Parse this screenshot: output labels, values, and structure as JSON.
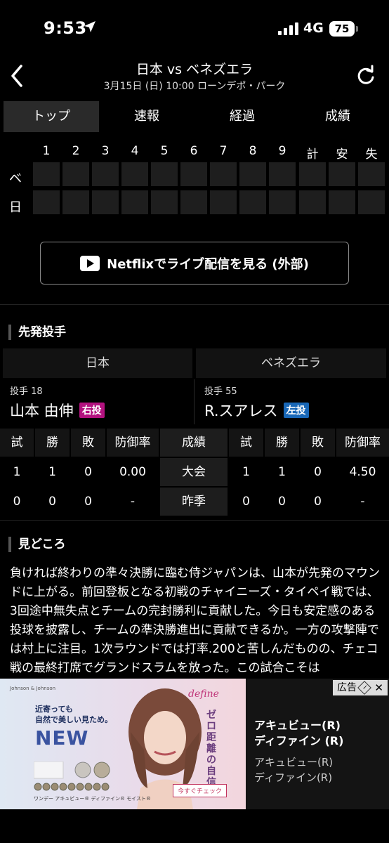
{
  "status": {
    "time": "9:53",
    "network": "4G",
    "battery": "75"
  },
  "header": {
    "title": "日本 vs ベネズエラ",
    "subtitle": "3月15日 (日) 10:00 ローンデポ・パーク"
  },
  "tabs": [
    {
      "label": "トップ",
      "active": true
    },
    {
      "label": "速報",
      "active": false
    },
    {
      "label": "経過",
      "active": false
    },
    {
      "label": "成績",
      "active": false
    }
  ],
  "scoreboard": {
    "columns": [
      "1",
      "2",
      "3",
      "4",
      "5",
      "6",
      "7",
      "8",
      "9",
      "計",
      "安",
      "失"
    ],
    "rows": [
      {
        "label": "ベ"
      },
      {
        "label": "日"
      }
    ]
  },
  "netflix_button": {
    "label": "Netflixでライブ配信を見る (外部)"
  },
  "starters": {
    "heading": "先発投手",
    "home": {
      "team": "日本",
      "number": "投手 18",
      "name": "山本 由伸",
      "hand": "右投"
    },
    "away": {
      "team": "ベネズエラ",
      "number": "投手 55",
      "name": "R.スアレス",
      "hand": "左投"
    }
  },
  "stats": {
    "headers": [
      "試",
      "勝",
      "敗",
      "防御率"
    ],
    "mid_header": "成績",
    "rows": [
      {
        "label": "大会",
        "home": [
          "1",
          "1",
          "0",
          "0.00"
        ],
        "away": [
          "1",
          "1",
          "0",
          "4.50"
        ]
      },
      {
        "label": "昨季",
        "home": [
          "0",
          "0",
          "0",
          "-"
        ],
        "away": [
          "0",
          "0",
          "0",
          "-"
        ]
      }
    ]
  },
  "highlights": {
    "heading": "見どころ",
    "text": "負ければ終わりの準々決勝に臨む侍ジャパンは、山本が先発のマウンドに上がる。前回登板となる初戦のチャイニーズ・タイペイ戦では、3回途中無失点とチームの完封勝利に貢献した。今日も安定感のある投球を披露し、チームの準決勝進出に貢献できるか。一方の攻撃陣では村上に注目。1次ラウンドでは打率.200と苦しんだものの、チェコ戦の最終打席でグランドスラムを放った。この試合こそは"
  },
  "ad": {
    "label": "広告",
    "image": {
      "brand": "Johnson & Johnson",
      "tagline": [
        "近寄っても",
        "自然で美しい見ため。"
      ],
      "new": "NEW",
      "logo": "define",
      "vertical_copy": "ゼロ距離の自信",
      "cta": "今すぐチェック",
      "product": "ワンデー アキュビュー® ディファイン® モイスト®"
    },
    "title_lines": [
      "アキュビュー(R)",
      "ディファイン (R)"
    ],
    "desc_lines": [
      "アキュビュー(R)",
      "ディファイン(R)"
    ]
  },
  "colors": {
    "right_hand": "#b3127f",
    "left_hand": "#1867b7"
  }
}
